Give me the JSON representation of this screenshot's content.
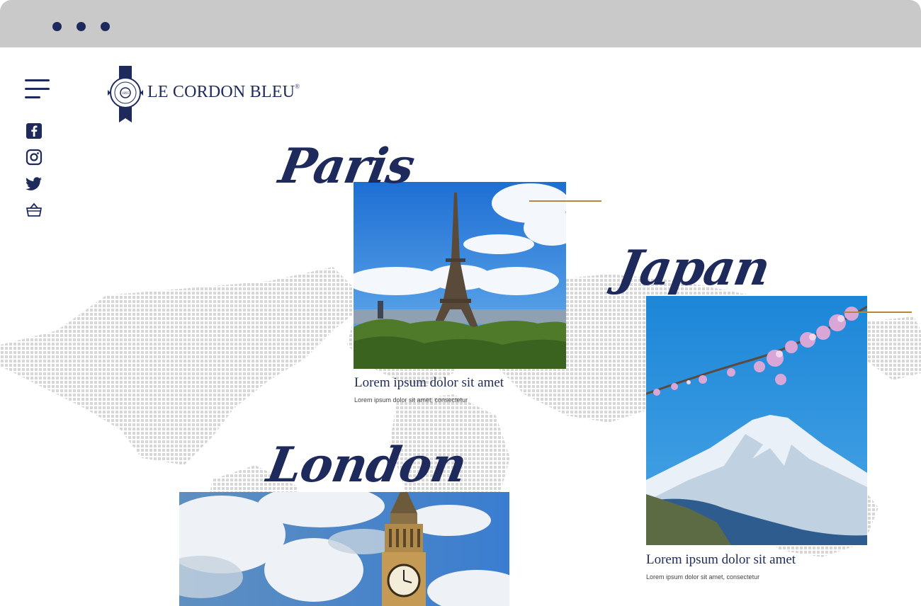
{
  "window": {
    "controls": [
      "dot",
      "dot",
      "dot"
    ]
  },
  "brand": {
    "name": "LE CORDON BLEU",
    "mark": "®",
    "seal_year": "1895"
  },
  "nav": {
    "menu_icon": "hamburger-icon",
    "social": [
      "facebook-icon",
      "instagram-icon",
      "twitter-icon",
      "basket-icon"
    ]
  },
  "cities": {
    "paris": {
      "title": "Paris",
      "caption": "Lorem ipsum dolor sit amet",
      "sub": "Lorem ipsum dolor sit amet, consectetur"
    },
    "japan": {
      "title": "Japan",
      "caption": "Lorem ipsum dolor sit amet",
      "sub": "Lorem ipsum dolor sit amet, consectetur"
    },
    "london": {
      "title": "London"
    }
  },
  "colors": {
    "navy": "#1f2a5c",
    "accent_gold": "#b8863b",
    "chrome": "#c9c9c9",
    "map_dots": "#d6d6d6"
  }
}
